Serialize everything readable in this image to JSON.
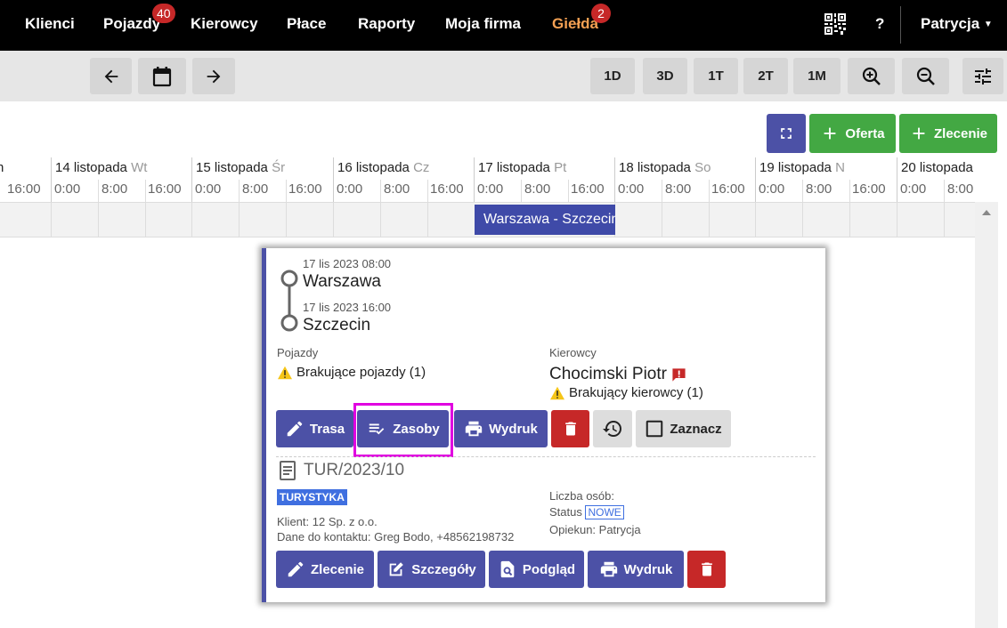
{
  "nav": {
    "items": [
      {
        "label": "Klienci"
      },
      {
        "label": "Pojazdy",
        "badge": "40"
      },
      {
        "label": "Kierowcy"
      },
      {
        "label": "Płace"
      },
      {
        "label": "Raporty"
      },
      {
        "label": "Moja firma"
      },
      {
        "label": "Giełda",
        "badge": "2",
        "color": "#f5a153"
      }
    ],
    "help": "?",
    "user": "Patrycja"
  },
  "toolbar": {
    "zoom_levels": [
      "1D",
      "3D",
      "1T",
      "2T",
      "1M"
    ]
  },
  "actions": {
    "offer": "Oferta",
    "order": "Zlecenie"
  },
  "timeline": {
    "partial_first_day": "n",
    "hours": [
      "0:00",
      "8:00",
      "16:00"
    ],
    "days": [
      {
        "label": "14 listopada",
        "weekday": "Wt"
      },
      {
        "label": "15 listopada",
        "weekday": "Śr"
      },
      {
        "label": "16 listopada",
        "weekday": "Cz"
      },
      {
        "label": "17 listopada",
        "weekday": "Pt"
      },
      {
        "label": "18 listopada",
        "weekday": "So"
      },
      {
        "label": "19 listopada",
        "weekday": "N"
      },
      {
        "label": "20 listopada",
        "weekday": ""
      }
    ],
    "event": {
      "label": "Warszawa - Szczecin"
    }
  },
  "popup": {
    "route": [
      {
        "time": "17 lis 2023 08:00",
        "city": "Warszawa"
      },
      {
        "time": "17 lis 2023 16:00",
        "city": "Szczecin"
      }
    ],
    "vehicles": {
      "heading": "Pojazdy",
      "warning": "Brakujące pojazdy (1)"
    },
    "drivers": {
      "heading": "Kierowcy",
      "name": "Chocimski Piotr",
      "warning": "Brakujący kierowcy (1)"
    },
    "buttons1": {
      "route": "Trasa",
      "resources": "Zasoby",
      "print": "Wydruk",
      "select": "Zaznacz"
    },
    "order": {
      "number": "TUR/2023/10",
      "tag": "TURYSTYKA",
      "client": "Klient: 12 Sp. z o.o.",
      "contact": "Dane do kontaktu: Greg Bodo, +48562198732",
      "persons": "Liczba osób:",
      "status_label": "Status",
      "status_value": "NOWE",
      "manager": "Opiekun: Patrycja"
    },
    "buttons2": {
      "order": "Zlecenie",
      "details": "Szczegóły",
      "preview": "Podgląd",
      "print": "Wydruk"
    }
  }
}
